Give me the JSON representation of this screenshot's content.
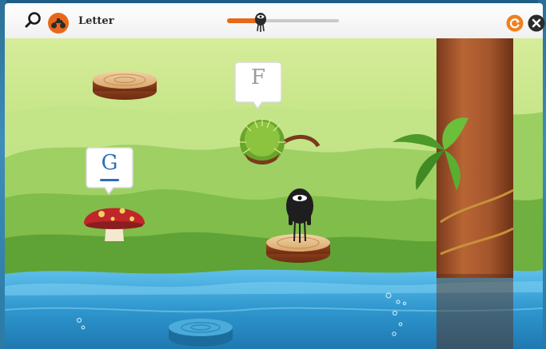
{
  "app": {
    "title": "Letter"
  },
  "toolbar": {
    "search_icon": "search-icon",
    "vehicle_icon": "motorbike-icon",
    "restart_icon": "restart-icon",
    "close_icon": "close-icon",
    "progress": 0.3
  },
  "scene": {
    "letters": [
      {
        "letter": "F",
        "attached_to": "chestnut"
      },
      {
        "letter": "G",
        "attached_to": "mushroom",
        "highlighted": true
      }
    ]
  },
  "colors": {
    "accent_orange": "#e8671a",
    "letter_blue": "#2a6fb8",
    "sky_green": "#a8d56a",
    "water_blue": "#3aa6d8"
  }
}
